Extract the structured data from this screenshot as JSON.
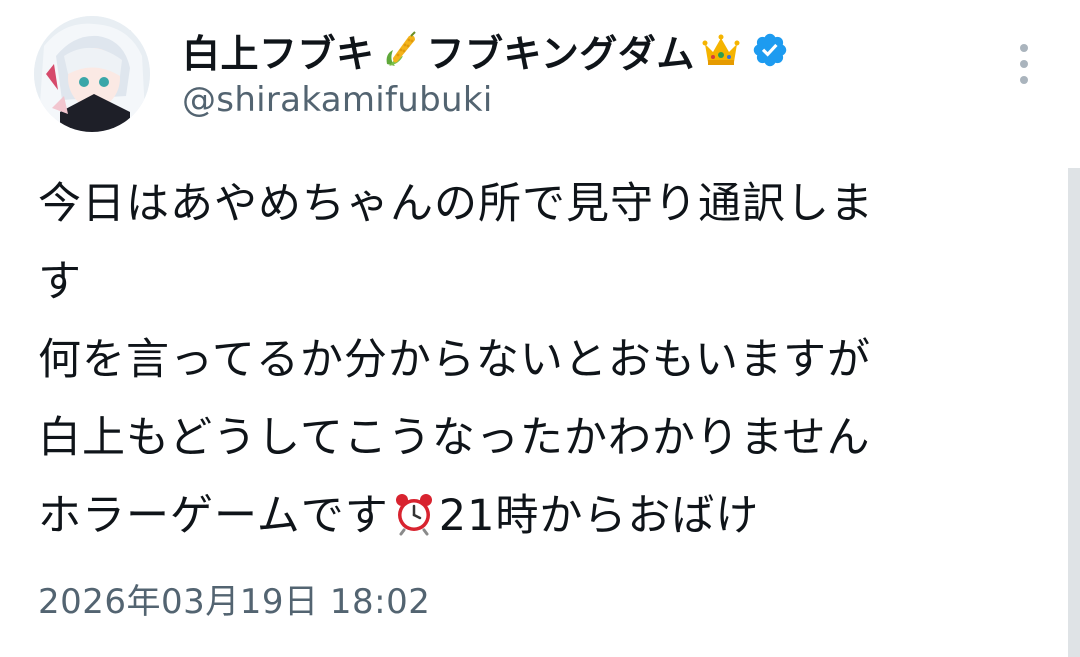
{
  "author": {
    "name_part1": "白上フブキ",
    "name_part2": "フブキングダム",
    "name_emoji_1": "corn-emoji",
    "name_emoji_2": "crown-emoji",
    "verified": true,
    "handle": "@shirakamifubuki"
  },
  "tweet": {
    "line1": "今日はあやめちゃんの所で見守り通訳しま",
    "line2": "す",
    "line3": "何を言ってるか分からないとおもいますが",
    "line4": "白上もどうしてこうなったかわかりません",
    "line5_before": "ホラーゲームです",
    "line5_emoji": "alarm-clock-emoji",
    "line5_after": "21時からおばけ"
  },
  "timestamp": "2026年03月19日 18:02",
  "colors": {
    "text": "#0f1419",
    "secondary": "#536471",
    "verified_blue": "#1d9bf0"
  }
}
